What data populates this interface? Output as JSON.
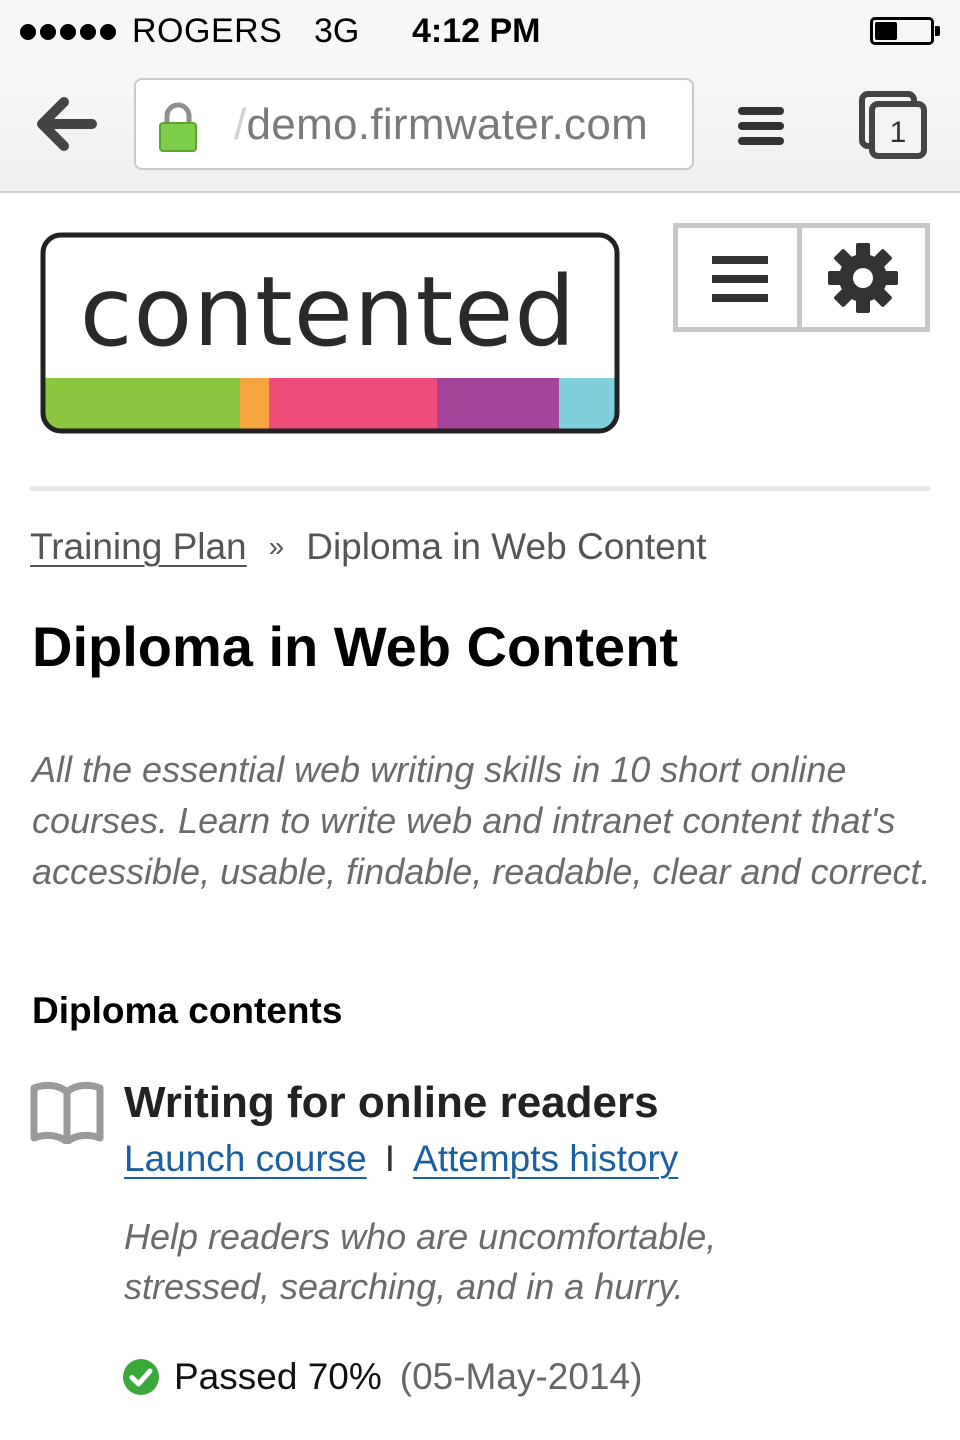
{
  "status_bar": {
    "carrier": "ROGERS",
    "network": "3G",
    "time": "4:12 PM",
    "signal_bars": 5,
    "battery_level": 0.4
  },
  "browser": {
    "url_prefix": "/",
    "url": "demo.firmwater.com",
    "secure": true,
    "tab_count": "1",
    "icons": {
      "back": "back-arrow-icon",
      "lock": "lock-icon",
      "menu": "menu-icon",
      "tabs": "tabs-icon"
    }
  },
  "header": {
    "logo_text": "contented",
    "logo_stripe_colors": [
      "#8cc63f",
      "#f7a541",
      "#ee4c7a",
      "#a3449a",
      "#7fd0dc"
    ],
    "menu_icon": "hamburger-icon",
    "settings_icon": "gear-icon"
  },
  "breadcrumb": {
    "parent": "Training Plan",
    "separator": "»",
    "current": "Diploma in Web Content"
  },
  "page": {
    "title": "Diploma in Web Content",
    "intro": "All the essential web writing skills in 10 short online courses. Learn to write web and intranet content that's accessible, usable, findable, readable, clear and correct.",
    "section_heading": "Diploma contents"
  },
  "courses": [
    {
      "icon": "book-icon",
      "title": "Writing for online readers",
      "launch_label": "Launch course",
      "separator": "I",
      "history_label": "Attempts history",
      "description": "Help readers who are uncomfortable, stressed, searching, and in a hurry.",
      "status_icon": "check-circle-icon",
      "status": "Passed 70%",
      "date": "(05-May-2014)"
    }
  ],
  "colors": {
    "link": "#1a5fa0",
    "pass": "#3aa93a",
    "muted_text": "#6b6b6b"
  }
}
